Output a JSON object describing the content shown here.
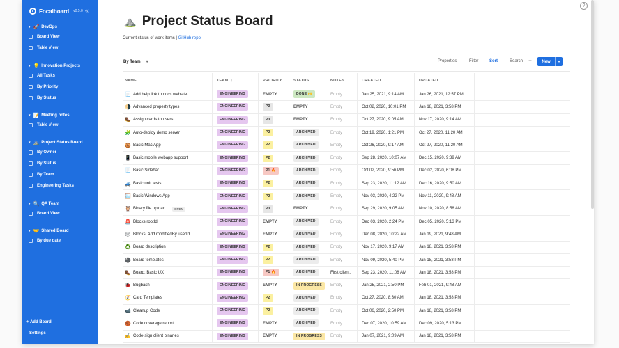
{
  "app": {
    "name": "Focalboard",
    "version": "v0.5.0"
  },
  "sidebar": {
    "groups": [
      {
        "title": "DevOps",
        "emoji": "🚀",
        "views": [
          "Board View",
          "Table View"
        ]
      },
      {
        "title": "Innovation Projects",
        "emoji": "💡",
        "views": [
          "All Tasks",
          "By Priority",
          "By Status"
        ]
      },
      {
        "title": "Meeting notes",
        "emoji": "📝",
        "views": [
          "Table View"
        ]
      },
      {
        "title": "Project Status Board",
        "emoji": "⛰️",
        "views": [
          "By Owner",
          "By Status",
          "By Team",
          "Engineering Tasks"
        ]
      },
      {
        "title": "QA Team",
        "emoji": "🔍",
        "views": [
          "Board View"
        ]
      },
      {
        "title": "Shared Board",
        "emoji": "🤝",
        "views": [
          "By due date"
        ]
      }
    ],
    "add_board": "+ Add Board",
    "settings": "Settings"
  },
  "page": {
    "emoji": "⛰️",
    "title": "Project Status Board",
    "description": "Current status of work items | ",
    "link": "GitHub repo"
  },
  "toolbar": {
    "group_by": "By Team",
    "properties": "Properties",
    "filter": "Filter",
    "sort": "Sort",
    "search": "Search",
    "more": "···",
    "new": "New"
  },
  "table": {
    "headers": {
      "name": "NAME",
      "team": "TEAM",
      "sort_arrow": "↓",
      "priority": "PRIORITY",
      "status": "STATUS",
      "notes": "NOTES",
      "created": "CREATED",
      "updated": "UPDATED"
    },
    "rows": [
      {
        "emoji": "📃",
        "name": "Add help link to docs website",
        "team": "ENGINEERING",
        "priority": "EMPTY",
        "status": "DONE 🙌",
        "notes": "Empty",
        "created": "Jan 25, 2021, 9:14 AM",
        "updated": "Jan 26, 2021, 12:57 PM"
      },
      {
        "emoji": "🌗",
        "name": "Advanced property types",
        "team": "ENGINEERING",
        "priority": "P3",
        "status": "EMPTY",
        "notes": "Empty",
        "created": "Oct 02, 2020, 10:01 PM",
        "updated": "Jan 18, 2021, 3:58 PM"
      },
      {
        "emoji": "🥾",
        "name": "Assign cards to users",
        "team": "ENGINEERING",
        "priority": "P3",
        "status": "EMPTY",
        "notes": "Empty",
        "created": "Oct 27, 2020, 9:05 AM",
        "updated": "Nov 17, 2020, 9:14 AM"
      },
      {
        "emoji": "🧩",
        "name": "Auto-deploy demo server",
        "team": "ENGINEERING",
        "priority": "P2",
        "status": "ARCHIVED",
        "notes": "Empty",
        "created": "Oct 19, 2020, 1:21 PM",
        "updated": "Oct 27, 2020, 11:20 AM"
      },
      {
        "emoji": "🍪",
        "name": "Basic Mac App",
        "team": "ENGINEERING",
        "priority": "P2",
        "status": "ARCHIVED",
        "notes": "Empty",
        "created": "Oct 26, 2020, 9:17 AM",
        "updated": "Oct 27, 2020, 11:20 AM"
      },
      {
        "emoji": "📱",
        "name": "Basic mobile webapp support",
        "team": "ENGINEERING",
        "priority": "P2",
        "status": "ARCHIVED",
        "notes": "Empty",
        "created": "Sep 28, 2020, 10:07 AM",
        "updated": "Dec 15, 2020, 9:39 AM"
      },
      {
        "emoji": "📃",
        "name": "Basic Sidebar",
        "team": "ENGINEERING",
        "priority": "P1 🔥",
        "status": "ARCHIVED",
        "notes": "Empty",
        "created": "Oct 02, 2020, 9:56 PM",
        "updated": "Dec 02, 2020, 6:08 PM"
      },
      {
        "emoji": "🚙",
        "name": "Basic unit tests",
        "team": "ENGINEERING",
        "priority": "P2",
        "status": "ARCHIVED",
        "notes": "Empty",
        "created": "Sep 23, 2020, 11:12 AM",
        "updated": "Dec 16, 2020, 9:50 AM"
      },
      {
        "emoji": "🪟",
        "name": "Basic Windows App",
        "team": "ENGINEERING",
        "priority": "P2",
        "status": "ARCHIVED",
        "notes": "Empty",
        "created": "Nov 03, 2020, 4:22 PM",
        "updated": "Nov 11, 2020, 9:48 AM"
      },
      {
        "emoji": "🦉",
        "name": "Binary file upload",
        "open": "OPEN",
        "team": "ENGINEERING",
        "priority": "P3",
        "status": "EMPTY",
        "notes": "Empty",
        "created": "Sep 29, 2020, 9:05 AM",
        "updated": "Nov 10, 2020, 8:58 AM"
      },
      {
        "emoji": "🚨",
        "name": "Blocks rootId",
        "team": "ENGINEERING",
        "priority": "EMPTY",
        "status": "ARCHIVED",
        "notes": "Empty",
        "created": "Dec 03, 2020, 2:24 PM",
        "updated": "Dec 05, 2020, 5:13 PM"
      },
      {
        "emoji": "🕸️",
        "name": "Blocks: Add modifiedBy userId",
        "team": "ENGINEERING",
        "priority": "EMPTY",
        "status": "ARCHIVED",
        "notes": "Empty",
        "created": "Dec 08, 2020, 10:22 AM",
        "updated": "Jan 19, 2021, 9:48 AM"
      },
      {
        "emoji": "♻️",
        "name": "Board description",
        "team": "ENGINEERING",
        "priority": "P2",
        "status": "ARCHIVED",
        "notes": "Empty",
        "created": "Nov 17, 2020, 9:17 AM",
        "updated": "Jan 18, 2021, 3:58 PM"
      },
      {
        "emoji": "🎱",
        "name": "Board templates",
        "team": "ENGINEERING",
        "priority": "P2",
        "status": "ARCHIVED",
        "notes": "Empty",
        "created": "Nov 09, 2020, 5:40 PM",
        "updated": "Jan 18, 2021, 3:58 PM"
      },
      {
        "emoji": "🥾",
        "name": "Board: Basic UX",
        "team": "ENGINEERING",
        "priority": "P1 🔥",
        "status": "ARCHIVED",
        "notes": "First client.",
        "created": "Sep 23, 2020, 11:08 AM",
        "updated": "Jan 18, 2021, 3:58 PM"
      },
      {
        "emoji": "🐞",
        "name": "Bugbash",
        "team": "ENGINEERING",
        "priority": "EMPTY",
        "status": "IN PROGRESS",
        "notes": "Empty",
        "created": "Jan 25, 2021, 2:50 PM",
        "updated": "Feb 01, 2021, 9:48 AM"
      },
      {
        "emoji": "🧭",
        "name": "Card Templates",
        "team": "ENGINEERING",
        "priority": "P2",
        "status": "ARCHIVED",
        "notes": "Empty",
        "created": "Oct 27, 2020, 8:30 AM",
        "updated": "Jan 18, 2021, 3:58 PM"
      },
      {
        "emoji": "📹",
        "name": "Cleanup Code",
        "team": "ENGINEERING",
        "priority": "P2",
        "status": "ARCHIVED",
        "notes": "Empty",
        "created": "Oct 06, 2020, 2:50 PM",
        "updated": "Jan 18, 2021, 3:58 PM"
      },
      {
        "emoji": "🏀",
        "name": "Code coverage report",
        "team": "ENGINEERING",
        "priority": "EMPTY",
        "status": "ARCHIVED",
        "notes": "Empty",
        "created": "Dec 07, 2020, 10:59 AM",
        "updated": "Dec 09, 2020, 5:13 PM"
      },
      {
        "emoji": "✍️",
        "name": "Code-sign client binaries",
        "team": "ENGINEERING",
        "priority": "EMPTY",
        "status": "IN PROGRESS",
        "notes": "Empty",
        "created": "Jan 07, 2021, 9:09 AM",
        "updated": "Jan 18, 2021, 3:58 PM"
      }
    ]
  },
  "icons": {
    "help": "?",
    "collapse": "«",
    "group_chevron": "▾",
    "sidebar_chevron": "▾"
  },
  "colors": {
    "sidebar": "#1f6fe0",
    "accent": "#1f6fe0",
    "team_pill": "#e5c7ef",
    "p1": "#f7c8c3",
    "p2": "#fbf0a0",
    "p3": "#e6e6e6",
    "done": "#cde8c2",
    "in_progress": "#fbe7a5",
    "archived": "#ececec"
  }
}
